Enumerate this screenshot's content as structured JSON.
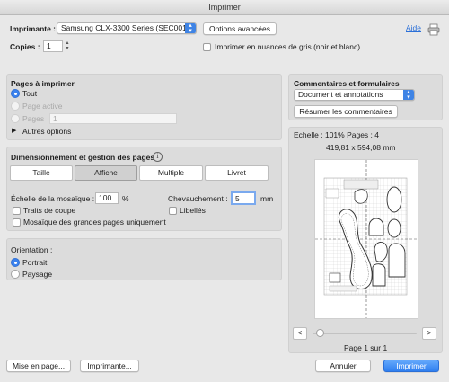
{
  "window": {
    "title": "Imprimer"
  },
  "header": {
    "printer_label": "Imprimante :",
    "printer_value": "Samsung CLX-3300 Series (SEC001...",
    "options_button": "Options avancées",
    "help_link": "Aide",
    "copies_label": "Copies :",
    "copies_value": "1",
    "grayscale_label": "Imprimer en nuances de gris (noir et blanc)"
  },
  "pages": {
    "title": "Pages à imprimer",
    "all_label": "Tout",
    "active_label": "Page active",
    "pages_label": "Pages",
    "pages_value": "1",
    "more_options_label": "Autres options"
  },
  "sizing": {
    "title": "Dimensionnement et gestion des pages",
    "info_icon": "info-icon",
    "buttons": [
      "Taille",
      "Affiche",
      "Multiple",
      "Livret"
    ],
    "active_button": "Affiche",
    "tile_scale_label": "Échelle de la mosaïque :",
    "tile_scale_value": "100",
    "tile_scale_unit": "%",
    "overlap_label": "Chevauchement :",
    "overlap_value": "5",
    "overlap_unit": "mm",
    "cut_marks_label": "Traits de coupe",
    "labels_label": "Libellés",
    "large_pages_label": "Mosaïque des grandes pages uniquement"
  },
  "orientation": {
    "title": "Orientation :",
    "portrait_label": "Portrait",
    "landscape_label": "Paysage"
  },
  "comments": {
    "title": "Commentaires et formulaires",
    "select_value": "Document et annotations",
    "summary_button": "Résumer les commentaires"
  },
  "preview": {
    "scale_text": "Echelle : 101% Pages : 4",
    "dimensions_text": "419,81 x 594,08 mm",
    "page_counter": "Page 1 sur 1",
    "prev_icon": "chevron-left-icon",
    "next_icon": "chevron-right-icon"
  },
  "footer": {
    "page_setup_button": "Mise en page...",
    "printer_button": "Imprimante...",
    "cancel_button": "Annuler",
    "print_button": "Imprimer"
  },
  "colors": {
    "accent": "#3b82ee"
  }
}
